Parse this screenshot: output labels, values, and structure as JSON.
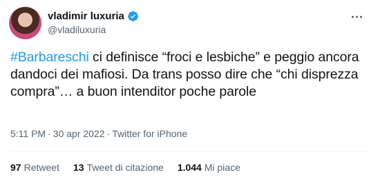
{
  "author": {
    "display_name": "vladimir luxuria",
    "handle": "@vladiluxuria",
    "verified_icon": "verified-badge-icon",
    "badge_color": "#1d9bf0"
  },
  "tweet": {
    "hashtag": "#Barbareschi",
    "text": " ci definisce “froci e lesbiche” e peggio ancora dandoci dei mafiosi. Da trans posso dire che “chi disprezza compra”… a buon intenditor poche parole"
  },
  "meta": {
    "time": "5:11 PM",
    "separator": "·",
    "date": "30 apr 2022",
    "source": "Twitter for iPhone"
  },
  "stats": {
    "retweets_count": "97",
    "retweets_label": "Retweet",
    "quotes_count": "13",
    "quotes_label": "Tweet di citazione",
    "likes_count": "1.044",
    "likes_label": "Mi piace"
  },
  "colors": {
    "link": "#1d9bf0",
    "secondary_text": "#536471",
    "primary_text": "#0f1419"
  }
}
